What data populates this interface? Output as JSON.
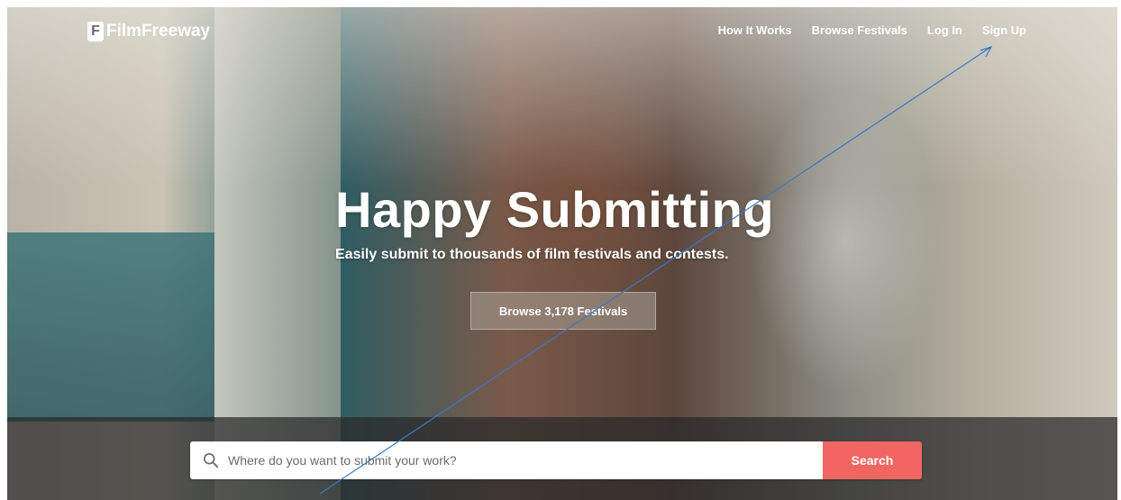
{
  "brand": {
    "logo_text": "FilmFreeway",
    "logo_mark": "F"
  },
  "nav": {
    "items": [
      {
        "label": "How It Works"
      },
      {
        "label": "Browse Festivals"
      },
      {
        "label": "Log In"
      },
      {
        "label": "Sign Up"
      }
    ]
  },
  "hero": {
    "title": "Happy Submitting",
    "subtitle": "Easily submit to thousands of film festivals and contests.",
    "browse_button": "Browse 3,178 Festivals"
  },
  "search": {
    "placeholder": "Where do you want to submit your work?",
    "button_label": "Search",
    "icon": "search-icon"
  },
  "colors": {
    "accent": "#f26661",
    "annotation_line": "#3a78c4"
  }
}
